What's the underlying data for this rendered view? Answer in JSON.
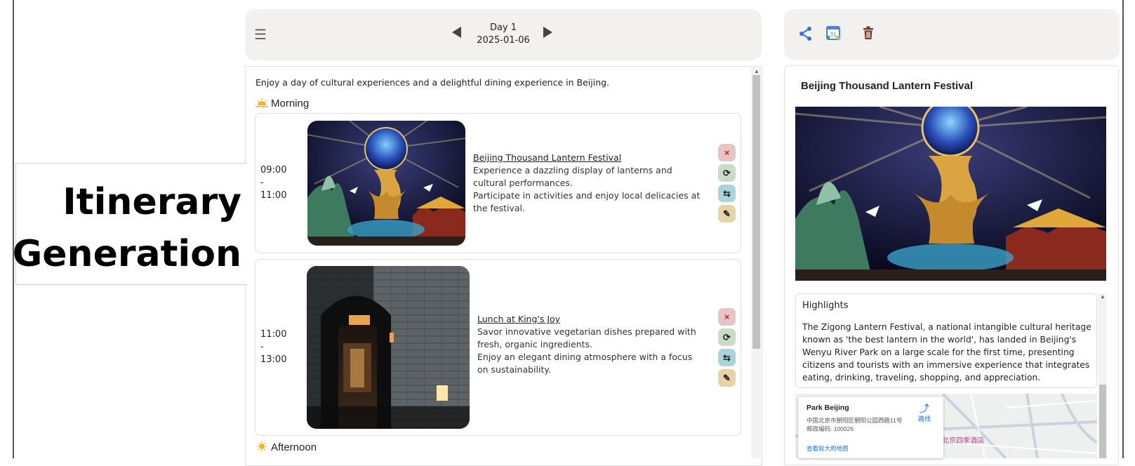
{
  "overlay_title": {
    "line1": "Itinerary",
    "line2": "Generation"
  },
  "day_nav": {
    "menu_icon": "hamburger-icon",
    "day_label": "Day 1",
    "date": "2025-01-06"
  },
  "intro_text": "Enjoy a day of cultural experiences and a delightful dining experience in Beijing.",
  "sections": {
    "morning": "Morning",
    "afternoon": "Afternoon"
  },
  "activities": [
    {
      "start": "09:00",
      "sep": "-",
      "end": "11:00",
      "title": "Beijing Thousand Lantern Festival",
      "line1": "Experience a dazzling display of lanterns and cultural performances.",
      "line2": "Participate in activities and enjoy local delicacies at the festival."
    },
    {
      "start": "11:00",
      "sep": "-",
      "end": "13:00",
      "title": "Lunch at King's Joy",
      "line1": "Savor innovative vegetarian dishes prepared with fresh, organic ingredients.",
      "line2": "Enjoy an elegant dining atmosphere with a focus on sustainability."
    }
  ],
  "action_buttons": {
    "remove": "×",
    "refresh": "⟳",
    "swap": "⇆",
    "edit": "✎"
  },
  "toolbar": {
    "share_icon": "share-icon",
    "calendar_icon": "google-calendar-icon",
    "calendar_day": "31",
    "delete_icon": "trash-icon"
  },
  "detail": {
    "title": "Beijing Thousand Lantern Festival",
    "highlights_title": "Highlights",
    "highlights_text": "The Zigong Lantern Festival, a national intangible cultural heritage known as 'the best lantern in the world', has landed in Beijing's Wenyu River Park on a large scale for the first time, presenting citizens and tourists with an immersive experience that integrates eating, drinking, traveling, shopping, and appreciation."
  },
  "map": {
    "place_name": "Park Beijing",
    "address": "中国北京市朝阳区朝阳公园西路11号",
    "postal": "邮政编码: 100026",
    "larger_map_link": "查看较大的地图",
    "route_label": "路线",
    "poi_hotel": "北京四季酒店"
  },
  "colors": {
    "accent_blue": "#3b6fe0",
    "delete_brown": "#7a3b2e",
    "remove_red": "#d21f1f"
  }
}
